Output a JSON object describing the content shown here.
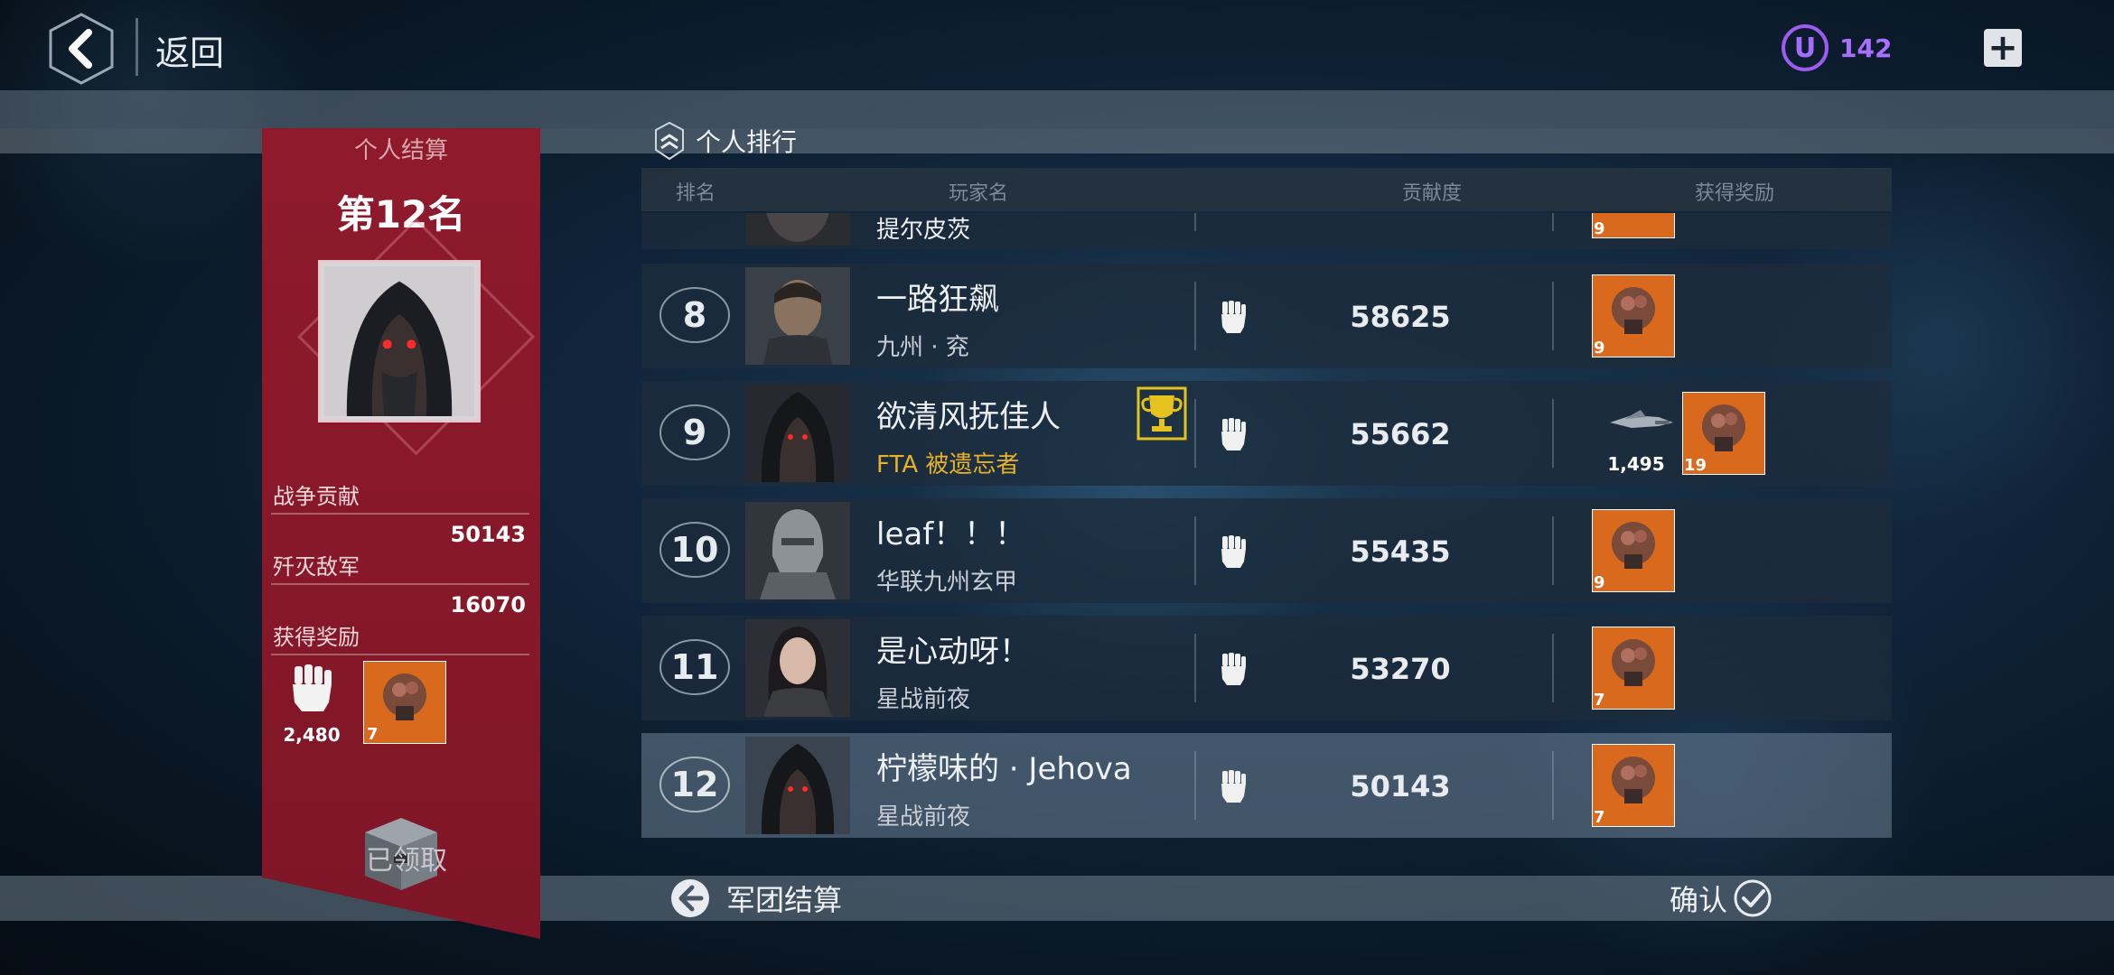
{
  "header": {
    "back_label": "返回",
    "currency_value": "142",
    "currency_symbol": "U",
    "add_symbol": "+"
  },
  "colors": {
    "panel": "#8f1a2c",
    "currency": "#a96fff",
    "guild_gold": "#e8b226",
    "reward_orange": "#e8751a"
  },
  "panel": {
    "title": "个人结算",
    "rank": "第12名",
    "contribution_label": "战争贡献",
    "contribution_value": "50143",
    "kills_label": "歼灭敌军",
    "kills_value": "16070",
    "rewards_label": "获得奖励",
    "reward_fist_count": "2,480",
    "reward_box_count": "7",
    "claimed_label": "已领取"
  },
  "ranking": {
    "title": "个人排行",
    "headers": {
      "rank": "排名",
      "player": "玩家名",
      "contribution": "贡献度",
      "reward": "获得奖励"
    },
    "partial_row": {
      "name": "提尔皮茨",
      "reward_count": "9"
    },
    "rows": [
      {
        "rank": "8",
        "name": "一路狂飙",
        "guild": "九州 · 兖",
        "contribution": "58625",
        "reward_count": "9",
        "avatar": "soldier"
      },
      {
        "rank": "9",
        "name": "欲清风抚佳人",
        "guild": "FTA 被遗忘者",
        "contribution": "55662",
        "ship_count": "1,495",
        "reward_count": "19",
        "avatar": "hooded",
        "trophy": "trophy-icon"
      },
      {
        "rank": "10",
        "name": "leaf！！！",
        "guild": "华联九州玄甲",
        "contribution": "55435",
        "reward_count": "9",
        "avatar": "armor"
      },
      {
        "rank": "11",
        "name": "是心动呀！",
        "guild": "星战前夜",
        "contribution": "53270",
        "reward_count": "7",
        "avatar": "woman"
      },
      {
        "rank": "12",
        "name": "柠檬味的 · Jehova",
        "guild": "星战前夜",
        "contribution": "50143",
        "reward_count": "7",
        "avatar": "hooded",
        "highlight": true
      }
    ]
  },
  "footer": {
    "legion_label": "军团结算",
    "confirm_label": "确认"
  }
}
